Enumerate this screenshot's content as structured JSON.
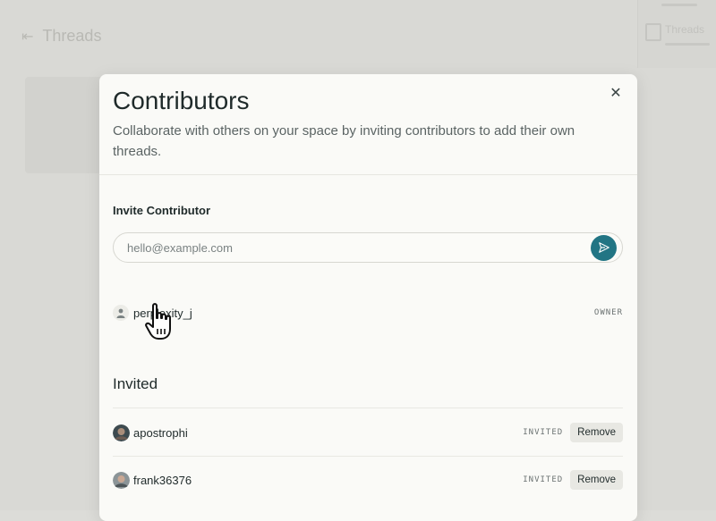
{
  "background": {
    "back_label": "Threads",
    "right_panel_label": "Threads"
  },
  "modal": {
    "title": "Contributors",
    "description": "Collaborate with others on your space by inviting contributors to add their own threads.",
    "close_icon": "close-icon",
    "invite": {
      "label": "Invite Contributor",
      "placeholder": "hello@example.com",
      "value": "",
      "send_icon": "send-icon"
    },
    "owner": {
      "name": "perplexity_j",
      "role": "OWNER"
    },
    "invited_heading": "Invited",
    "invited": [
      {
        "name": "apostrophi",
        "status": "INVITED",
        "action": "Remove"
      },
      {
        "name": "frank36376",
        "status": "INVITED",
        "action": "Remove"
      }
    ]
  },
  "colors": {
    "accent": "#227584",
    "backdrop": "#d9d9d5",
    "modal_bg": "#fafaf7"
  }
}
